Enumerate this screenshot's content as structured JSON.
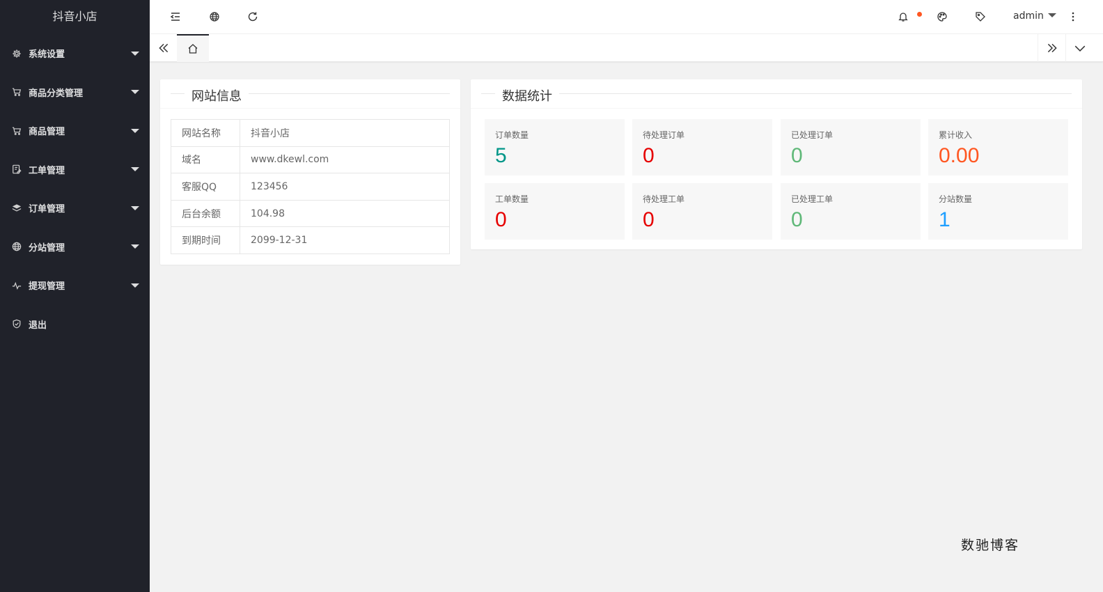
{
  "sidebar": {
    "logo": "抖音小店",
    "items": [
      {
        "label": "系统设置",
        "icon": "gear-icon"
      },
      {
        "label": "商品分类管理",
        "icon": "cart-icon"
      },
      {
        "label": "商品管理",
        "icon": "cart-icon"
      },
      {
        "label": "工单管理",
        "icon": "ticket-icon"
      },
      {
        "label": "订单管理",
        "icon": "layers-icon"
      },
      {
        "label": "分站管理",
        "icon": "globe-icon"
      },
      {
        "label": "提现管理",
        "icon": "pulse-icon"
      },
      {
        "label": "退出",
        "icon": "shield-icon"
      }
    ]
  },
  "header": {
    "user": "admin"
  },
  "site_info": {
    "title": "网站信息",
    "rows": [
      {
        "key": "网站名称",
        "value": "抖音小店"
      },
      {
        "key": "域名",
        "value": "www.dkewl.com"
      },
      {
        "key": "客服QQ",
        "value": "123456"
      },
      {
        "key": "后台余额",
        "value": "104.98"
      },
      {
        "key": "到期时间",
        "value": "2099-12-31"
      }
    ]
  },
  "stats": {
    "title": "数据统计",
    "items": [
      {
        "label": "订单数量",
        "value": "5",
        "color": "#009688"
      },
      {
        "label": "待处理订单",
        "value": "0",
        "color": "#e60000"
      },
      {
        "label": "已处理订单",
        "value": "0",
        "color": "#5fb878"
      },
      {
        "label": "累计收入",
        "value": "0.00",
        "color": "#ff5722"
      },
      {
        "label": "工单数量",
        "value": "0",
        "color": "#e60000"
      },
      {
        "label": "待处理工单",
        "value": "0",
        "color": "#e60000"
      },
      {
        "label": "已处理工单",
        "value": "0",
        "color": "#5fb878"
      },
      {
        "label": "分站数量",
        "value": "1",
        "color": "#1e9fff"
      }
    ]
  },
  "watermark": "数驰博客"
}
